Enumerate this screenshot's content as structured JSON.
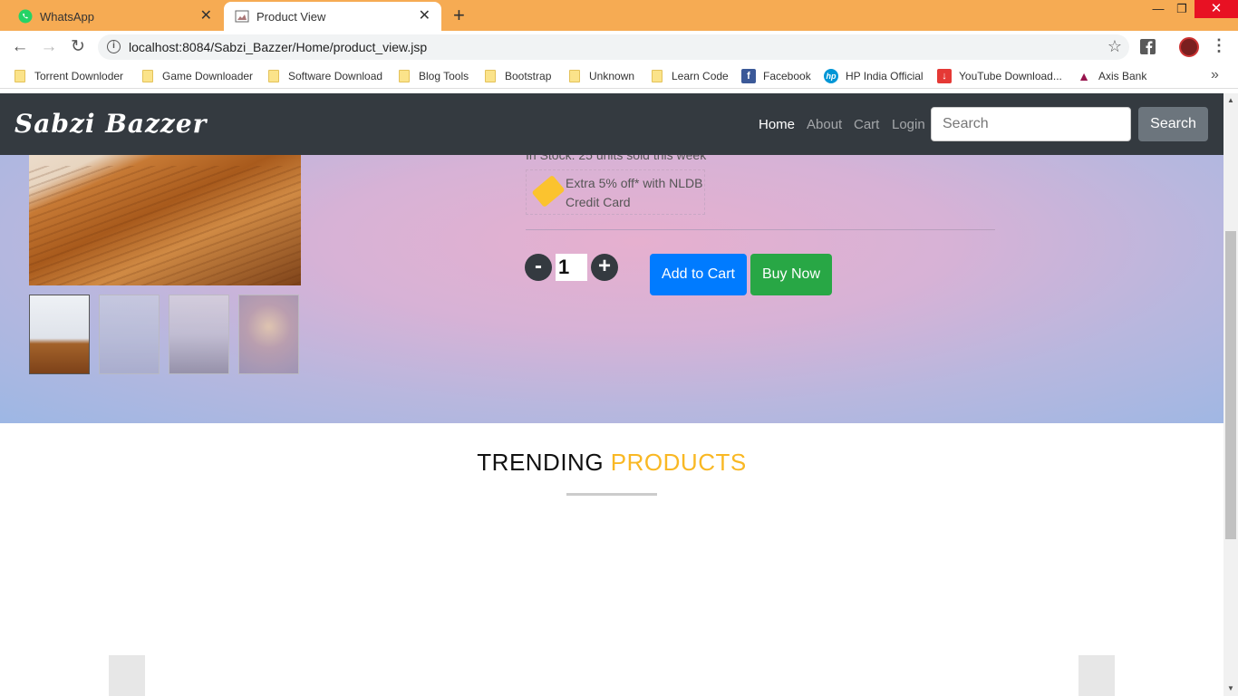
{
  "browser": {
    "tabs": [
      {
        "title": "WhatsApp",
        "icon": "whatsapp-icon"
      },
      {
        "title": "Product View",
        "icon": "page-icon"
      }
    ],
    "url": "localhost:8084/Sabzi_Bazzer/Home/product_view.jsp",
    "bookmarks": [
      "Torrent Downloder",
      "Game Downloader",
      "Software Download",
      "Blog Tools",
      "Bootstrap",
      "Unknown",
      "Learn Code",
      "Facebook",
      "HP India Official",
      "YouTube Download...",
      "Axis Bank"
    ]
  },
  "navbar": {
    "brand": "Sabzi Bazzer",
    "links": [
      "Home",
      "About",
      "Cart",
      "Login"
    ],
    "active_link": "Home",
    "search_placeholder": "Search",
    "search_button": "Search"
  },
  "product": {
    "stock_text": "In Stock: 25 units sold this week",
    "offer_text": "Extra 5% off* with NLDB Credit Card",
    "quantity": "1",
    "minus_label": "-",
    "plus_label": "+",
    "add_to_cart": "Add to Cart",
    "buy_now": "Buy Now"
  },
  "trending": {
    "title_part1": "TRENDING",
    "title_part2": "PRODUCTS"
  },
  "colors": {
    "navbar_bg": "#343a40",
    "primary": "#007bff",
    "success": "#28a745",
    "accent": "#f9b824",
    "tabbar": "#f6ab53"
  }
}
